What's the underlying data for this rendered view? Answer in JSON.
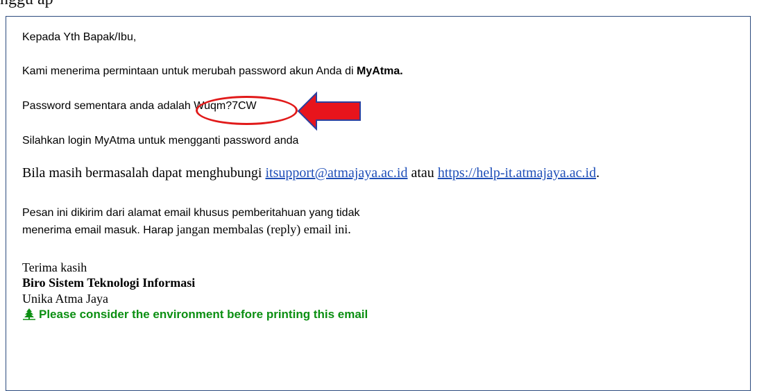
{
  "top_fragment": "nggu ap",
  "email": {
    "greeting": "Kepada Yth Bapak/Ibu,",
    "request_line": {
      "prefix": "Kami menerima permintaan untuk merubah password akun Anda di ",
      "app_name": "MyAtma."
    },
    "password_line": {
      "prefix": "Password sementara anda adalah ",
      "temp_password": "Wuqm?7CW"
    },
    "login_instruction": "Silahkan login MyAtma untuk mengganti password anda",
    "help_line": {
      "prefix": "Bila masih bermasalah dapat menghubungi ",
      "email_link": "itsupport@atmajaya.ac.id",
      "middle": " atau ",
      "url_link": "https://help-it.atmajaya.ac.id",
      "suffix": "."
    },
    "notice_line1": "Pesan ini dikirim dari alamat email khusus pemberitahuan yang tidak",
    "notice_line2_sans": "menerima email masuk. Harap ",
    "notice_line2_serif": "jangan membalas (reply) email ini.",
    "signature": {
      "thanks": "Terima kasih",
      "department": "Biro Sistem Teknologi Informasi",
      "institution": "Unika Atma Jaya"
    },
    "eco_notice": "Please consider the environment before printing this email"
  },
  "annotation": {
    "oval_color": "#e11a1a",
    "arrow_color": "#e8141c",
    "arrow_outline": "#2b3f9e"
  },
  "colors": {
    "link": "#1f4fb8",
    "eco_green": "#0b8f12",
    "frame": "#2b4a7d"
  },
  "icons": {
    "eco": "recycle-tree-icon"
  }
}
